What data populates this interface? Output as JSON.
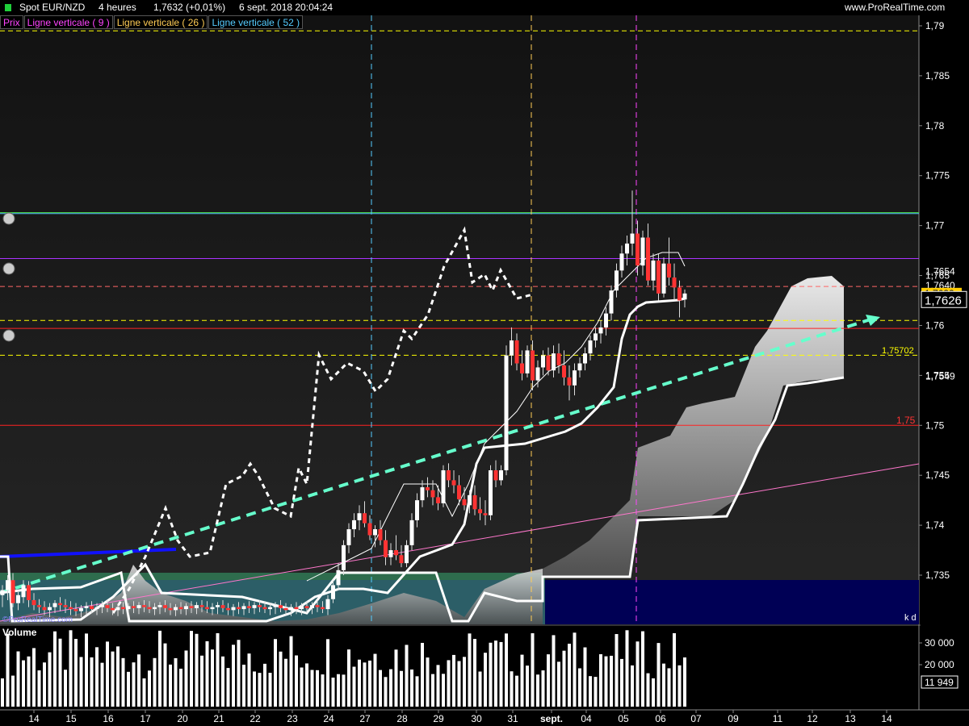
{
  "header": {
    "instrument": "Spot EUR/NZD",
    "timeframe": "4 heures",
    "last": "1,7632 (+0,01%)",
    "datetime": "6 sept. 2018 20:04:24",
    "site": "www.ProRealTime.com"
  },
  "legend": [
    {
      "label": "Prix",
      "color": "#ff44ff"
    },
    {
      "label": "Ligne verticale ( 9 )",
      "color": "#ff44ff"
    },
    {
      "label": "Ligne verticale ( 26 )",
      "color": "#ffcc55"
    },
    {
      "label": "Ligne verticale ( 52 )",
      "color": "#55ccff"
    }
  ],
  "price_axis": {
    "ticks": [
      "1,79",
      "1,785",
      "1,78",
      "1,775",
      "1,77",
      "1,765",
      "1,76",
      "1,755",
      "1,75",
      "1,745",
      "1,74",
      "1,735"
    ],
    "labels": [
      {
        "text": "1,7654",
        "value": 1.7654,
        "style": "plain"
      },
      {
        "text": "1,7640",
        "value": 1.764,
        "style": "plain"
      },
      {
        "text": "1,7632",
        "value": 1.7632,
        "style": "yellow"
      },
      {
        "text": "1,7626",
        "value": 1.7626,
        "style": "boxed"
      },
      {
        "text": "1,7549",
        "value": 1.7549,
        "style": "plain"
      }
    ]
  },
  "annotations": [
    {
      "text": "1,75702",
      "value": 1.75702,
      "color": "#ffff00"
    },
    {
      "text": "1,75",
      "value": 1.75,
      "color": "#ff3333"
    },
    {
      "text": "k d",
      "color": "#ffffff"
    },
    {
      "text": "©ProRealTime.com",
      "color": "#8888ff"
    }
  ],
  "volume": {
    "title": "Volume",
    "ticks": [
      "30 000",
      "20 000"
    ],
    "last_label": "11 949"
  },
  "time_axis": [
    "14",
    "15",
    "16",
    "17",
    "20",
    "21",
    "22",
    "23",
    "24",
    "27",
    "28",
    "29",
    "30",
    "31",
    "sept.",
    "04",
    "05",
    "06",
    "07",
    "09",
    "11",
    "12",
    "13",
    "14"
  ],
  "colors": {
    "up": "#ffffff",
    "down": "#ff3333",
    "cloud": "#c8c8c8",
    "trend": "#66ffcc",
    "blue_line": "#1111ff",
    "pink_line": "#ff77cc",
    "lagging": "#ffffff",
    "vline9": "#ff44ff",
    "vline26": "#ffcc55",
    "vline52": "#55ccff"
  },
  "chart_data": {
    "type": "candlestick",
    "ylim": [
      1.7315,
      1.7915
    ],
    "horizontal_lines": [
      {
        "value": 1.7895,
        "color": "#ffff00",
        "style": "dashed"
      },
      {
        "value": 1.7713,
        "color": "#44cc44",
        "style": "solid"
      },
      {
        "value": 1.7712,
        "color": "#55ccff",
        "style": "solid"
      },
      {
        "value": 1.7667,
        "color": "#aa33ff",
        "style": "solid"
      },
      {
        "value": 1.7639,
        "color": "#ff6666",
        "style": "dashed"
      },
      {
        "value": 1.7605,
        "color": "#ffff00",
        "style": "dashed"
      },
      {
        "value": 1.7597,
        "color": "#ff2222",
        "style": "solid"
      },
      {
        "value": 1.75702,
        "color": "#ffff00",
        "style": "dashed"
      },
      {
        "value": 1.75,
        "color": "#ff2222",
        "style": "solid"
      }
    ],
    "vertical_lines": [
      {
        "label": "Ligne verticale ( 52 )",
        "date": "27 août",
        "color": "#55ccff"
      },
      {
        "label": "Ligne verticale ( 26 )",
        "date": "31 août",
        "color": "#ffcc55"
      },
      {
        "label": "Ligne verticale ( 9 )",
        "date": "05 sept.",
        "color": "#ff44ff"
      }
    ],
    "candles": [
      [
        1.733,
        1.734,
        1.7318,
        1.7335
      ],
      [
        1.7335,
        1.735,
        1.7325,
        1.7345
      ],
      [
        1.7345,
        1.7352,
        1.7318,
        1.7322
      ],
      [
        1.7322,
        1.7333,
        1.7315,
        1.733
      ],
      [
        1.7328,
        1.7345,
        1.7322,
        1.734
      ],
      [
        1.734,
        1.7344,
        1.7318,
        1.7325
      ],
      [
        1.7325,
        1.7332,
        1.7315,
        1.732
      ],
      [
        1.732,
        1.7326,
        1.7312,
        1.7318
      ],
      [
        1.7318,
        1.7324,
        1.731,
        1.7315
      ],
      [
        1.7315,
        1.7322,
        1.7308,
        1.7318
      ],
      [
        1.7318,
        1.7325,
        1.7312,
        1.7322
      ],
      [
        1.7322,
        1.7328,
        1.7314,
        1.732
      ],
      [
        1.732,
        1.7326,
        1.7312,
        1.7318
      ],
      [
        1.7318,
        1.7324,
        1.731,
        1.7316
      ],
      [
        1.7316,
        1.7322,
        1.7309,
        1.7314
      ],
      [
        1.7314,
        1.732,
        1.7308,
        1.7317
      ],
      [
        1.7317,
        1.7323,
        1.731,
        1.7319
      ],
      [
        1.7319,
        1.7324,
        1.7312,
        1.7316
      ],
      [
        1.7316,
        1.7322,
        1.731,
        1.7318
      ],
      [
        1.7318,
        1.7324,
        1.7312,
        1.732
      ],
      [
        1.732,
        1.7325,
        1.7313,
        1.7317
      ],
      [
        1.7317,
        1.7322,
        1.731,
        1.7315
      ],
      [
        1.7315,
        1.7321,
        1.7309,
        1.7318
      ],
      [
        1.7318,
        1.7323,
        1.7311,
        1.7316
      ],
      [
        1.7316,
        1.7322,
        1.731,
        1.7319
      ],
      [
        1.7319,
        1.7324,
        1.7312,
        1.7317
      ],
      [
        1.7317,
        1.7323,
        1.7311,
        1.732
      ],
      [
        1.732,
        1.7325,
        1.7313,
        1.7318
      ],
      [
        1.7318,
        1.7324,
        1.7312,
        1.7316
      ],
      [
        1.7316,
        1.7322,
        1.731,
        1.7318
      ],
      [
        1.7318,
        1.7323,
        1.7311,
        1.732
      ],
      [
        1.732,
        1.7325,
        1.7313,
        1.7317
      ],
      [
        1.7317,
        1.7322,
        1.731,
        1.7315
      ],
      [
        1.7315,
        1.7321,
        1.7309,
        1.7318
      ],
      [
        1.7318,
        1.7323,
        1.7311,
        1.7316
      ],
      [
        1.7316,
        1.7322,
        1.731,
        1.7319
      ],
      [
        1.7319,
        1.7324,
        1.7312,
        1.7317
      ],
      [
        1.7317,
        1.7323,
        1.7311,
        1.732
      ],
      [
        1.732,
        1.7325,
        1.7313,
        1.7318
      ],
      [
        1.7318,
        1.7324,
        1.7312,
        1.7316
      ],
      [
        1.7316,
        1.7322,
        1.731,
        1.7318
      ],
      [
        1.7318,
        1.7323,
        1.7311,
        1.732
      ],
      [
        1.732,
        1.7325,
        1.7313,
        1.7317
      ],
      [
        1.7317,
        1.7322,
        1.731,
        1.7315
      ],
      [
        1.7315,
        1.7321,
        1.7309,
        1.7318
      ],
      [
        1.7318,
        1.7323,
        1.7311,
        1.7316
      ],
      [
        1.7316,
        1.7322,
        1.731,
        1.7319
      ],
      [
        1.7319,
        1.7324,
        1.7312,
        1.7317
      ],
      [
        1.7317,
        1.7323,
        1.7311,
        1.732
      ],
      [
        1.732,
        1.7325,
        1.7313,
        1.7318
      ],
      [
        1.7318,
        1.7324,
        1.7312,
        1.7316
      ],
      [
        1.7316,
        1.7322,
        1.731,
        1.7318
      ],
      [
        1.7318,
        1.7323,
        1.7311,
        1.732
      ],
      [
        1.732,
        1.7325,
        1.7313,
        1.7317
      ],
      [
        1.7317,
        1.7322,
        1.731,
        1.7315
      ],
      [
        1.7315,
        1.7321,
        1.7309,
        1.7318
      ],
      [
        1.7318,
        1.7323,
        1.7311,
        1.7316
      ],
      [
        1.7316,
        1.7322,
        1.731,
        1.7319
      ],
      [
        1.7319,
        1.7324,
        1.7312,
        1.7317
      ],
      [
        1.7317,
        1.7323,
        1.7311,
        1.732
      ],
      [
        1.732,
        1.7325,
        1.7313,
        1.7318
      ],
      [
        1.7318,
        1.7324,
        1.7312,
        1.7316
      ],
      [
        1.7316,
        1.733,
        1.731,
        1.7326
      ],
      [
        1.7326,
        1.7345,
        1.7322,
        1.734
      ],
      [
        1.734,
        1.7362,
        1.7335,
        1.7355
      ],
      [
        1.7355,
        1.7385,
        1.735,
        1.738
      ],
      [
        1.738,
        1.7402,
        1.7372,
        1.7396
      ],
      [
        1.7396,
        1.7412,
        1.7388,
        1.7405
      ],
      [
        1.7405,
        1.742,
        1.7395,
        1.7412
      ],
      [
        1.7412,
        1.7424,
        1.7398,
        1.7402
      ],
      [
        1.7402,
        1.741,
        1.7385,
        1.739
      ],
      [
        1.739,
        1.74,
        1.7378,
        1.7396
      ],
      [
        1.7396,
        1.7405,
        1.738,
        1.7385
      ],
      [
        1.7385,
        1.7395,
        1.736,
        1.7368
      ],
      [
        1.7368,
        1.7382,
        1.736,
        1.7375
      ],
      [
        1.7375,
        1.739,
        1.7365,
        1.737
      ],
      [
        1.737,
        1.738,
        1.7358,
        1.7362
      ],
      [
        1.7362,
        1.7385,
        1.7358,
        1.738
      ],
      [
        1.738,
        1.7412,
        1.7375,
        1.7405
      ],
      [
        1.7405,
        1.7432,
        1.7398,
        1.7425
      ],
      [
        1.7425,
        1.7445,
        1.7418,
        1.7438
      ],
      [
        1.7438,
        1.7448,
        1.7428,
        1.7435
      ],
      [
        1.7435,
        1.7445,
        1.742,
        1.7428
      ],
      [
        1.7428,
        1.744,
        1.7415,
        1.7422
      ],
      [
        1.7422,
        1.746,
        1.7418,
        1.7455
      ],
      [
        1.7455,
        1.7462,
        1.7438,
        1.7445
      ],
      [
        1.7445,
        1.7455,
        1.7432,
        1.744
      ],
      [
        1.744,
        1.745,
        1.742,
        1.7426
      ],
      [
        1.7426,
        1.7438,
        1.7415,
        1.742
      ],
      [
        1.742,
        1.7435,
        1.7412,
        1.743
      ],
      [
        1.743,
        1.744,
        1.741,
        1.7416
      ],
      [
        1.7416,
        1.7428,
        1.7405,
        1.7412
      ],
      [
        1.7412,
        1.7425,
        1.74,
        1.741
      ],
      [
        1.741,
        1.746,
        1.7405,
        1.7455
      ],
      [
        1.7455,
        1.7465,
        1.7438,
        1.7445
      ],
      [
        1.7445,
        1.746,
        1.744,
        1.7455
      ],
      [
        1.7455,
        1.758,
        1.745,
        1.757
      ],
      [
        1.757,
        1.7598,
        1.756,
        1.7585
      ],
      [
        1.7585,
        1.7592,
        1.7555,
        1.7562
      ],
      [
        1.7562,
        1.7575,
        1.7545,
        1.7552
      ],
      [
        1.7552,
        1.758,
        1.7548,
        1.7575
      ],
      [
        1.7575,
        1.7585,
        1.7535,
        1.7545
      ],
      [
        1.7545,
        1.7565,
        1.7538,
        1.7558
      ],
      [
        1.7558,
        1.7575,
        1.755,
        1.757
      ],
      [
        1.757,
        1.7578,
        1.755,
        1.7555
      ],
      [
        1.7555,
        1.758,
        1.7548,
        1.7572
      ],
      [
        1.7572,
        1.7582,
        1.7552,
        1.756
      ],
      [
        1.756,
        1.7575,
        1.754,
        1.7548
      ],
      [
        1.7548,
        1.756,
        1.7525,
        1.754
      ],
      [
        1.754,
        1.7562,
        1.753,
        1.7555
      ],
      [
        1.7555,
        1.7568,
        1.7548,
        1.7562
      ],
      [
        1.7562,
        1.7578,
        1.7555,
        1.7572
      ],
      [
        1.7572,
        1.759,
        1.7565,
        1.7585
      ],
      [
        1.7585,
        1.7598,
        1.7578,
        1.7592
      ],
      [
        1.7592,
        1.7605,
        1.7582,
        1.7598
      ],
      [
        1.7598,
        1.7618,
        1.759,
        1.7612
      ],
      [
        1.7612,
        1.764,
        1.7605,
        1.7635
      ],
      [
        1.7635,
        1.7662,
        1.7628,
        1.7655
      ],
      [
        1.7655,
        1.768,
        1.7648,
        1.7672
      ],
      [
        1.7672,
        1.769,
        1.766,
        1.7682
      ],
      [
        1.7682,
        1.7735,
        1.767,
        1.7692
      ],
      [
        1.7692,
        1.7705,
        1.765,
        1.766
      ],
      [
        1.766,
        1.7695,
        1.765,
        1.7688
      ],
      [
        1.7688,
        1.7702,
        1.764,
        1.7645
      ],
      [
        1.7645,
        1.7672,
        1.7635,
        1.7665
      ],
      [
        1.7665,
        1.7672,
        1.7625,
        1.7632
      ],
      [
        1.7632,
        1.7668,
        1.7628,
        1.7662
      ],
      [
        1.7662,
        1.7688,
        1.764,
        1.7648
      ],
      [
        1.7648,
        1.7662,
        1.7625,
        1.7638
      ],
      [
        1.7638,
        1.7645,
        1.7608,
        1.7625
      ],
      [
        1.7626,
        1.7636,
        1.7618,
        1.7632
      ]
    ]
  }
}
